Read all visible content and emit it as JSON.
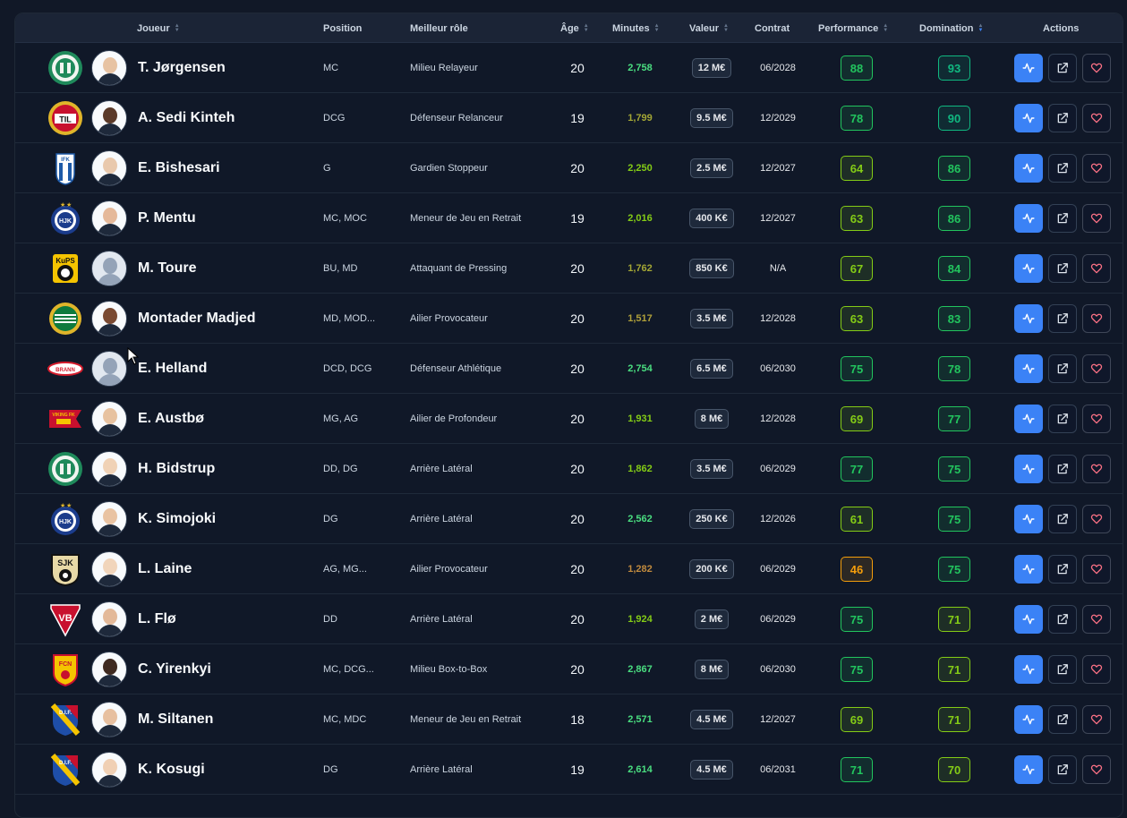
{
  "columns": {
    "player": "Joueur",
    "position": "Position",
    "best_role": "Meilleur rôle",
    "age": "Âge",
    "minutes": "Minutes",
    "value": "Valeur",
    "contract": "Contrat",
    "performance": "Performance",
    "domination": "Domination",
    "actions": "Actions"
  },
  "icons": {
    "stats_button": "activity-icon",
    "open_button": "external-link-icon",
    "favorite_button": "heart-icon",
    "sort": "sort-arrows-icon"
  },
  "colors": {
    "accent": "#3b82f6",
    "score_green": "#22c55e",
    "score_lime": "#84cc16",
    "score_amber": "#f59e0b"
  },
  "players": [
    {
      "name": "T. Jørgensen",
      "position": "MC",
      "role": "Milieu Relayeur",
      "age": "20",
      "minutes": "2,758",
      "value": "12 M€",
      "contract": "06/2028",
      "performance": "88",
      "domination": "93",
      "min_color": "#4ade80",
      "perf_color": "#22c55e",
      "dom_color": "#10b981",
      "crest": "green-round-crest"
    },
    {
      "name": "A. Sedi Kinteh",
      "position": "DCG",
      "role": "Défenseur Relanceur",
      "age": "19",
      "minutes": "1,799",
      "value": "9.5 M€",
      "contract": "12/2029",
      "performance": "78",
      "domination": "90",
      "min_color": "#a3a635",
      "perf_color": "#22c55e",
      "dom_color": "#10b981",
      "crest": "til-crest"
    },
    {
      "name": "E. Bishesari",
      "position": "G",
      "role": "Gardien Stoppeur",
      "age": "20",
      "minutes": "2,250",
      "value": "2.5 M€",
      "contract": "12/2027",
      "performance": "64",
      "domination": "86",
      "min_color": "#84cc16",
      "perf_color": "#84cc16",
      "dom_color": "#22c55e",
      "crest": "ifk-crest"
    },
    {
      "name": "P. Mentu",
      "position": "MC, MOC",
      "role": "Meneur de Jeu en Retrait",
      "age": "19",
      "minutes": "2,016",
      "value": "400 K€",
      "contract": "12/2027",
      "performance": "63",
      "domination": "86",
      "min_color": "#84cc16",
      "perf_color": "#84cc16",
      "dom_color": "#22c55e",
      "crest": "hjk-crest"
    },
    {
      "name": "M. Toure",
      "position": "BU, MD",
      "role": "Attaquant de Pressing",
      "age": "20",
      "minutes": "1,762",
      "value": "850 K€",
      "contract": "N/A",
      "performance": "67",
      "domination": "84",
      "min_color": "#a3a635",
      "perf_color": "#84cc16",
      "dom_color": "#22c55e",
      "crest": "kups-crest"
    },
    {
      "name": "Montader Madjed",
      "position": "MD, MOD...",
      "role": "Ailier Provocateur",
      "age": "20",
      "minutes": "1,517",
      "value": "3.5 M€",
      "contract": "12/2028",
      "performance": "63",
      "domination": "83",
      "min_color": "#b0a03a",
      "perf_color": "#84cc16",
      "dom_color": "#22c55e",
      "crest": "hammarby-crest"
    },
    {
      "name": "E. Helland",
      "position": "DCD, DCG",
      "role": "Défenseur Athlétique",
      "age": "20",
      "minutes": "2,754",
      "value": "6.5 M€",
      "contract": "06/2030",
      "performance": "75",
      "domination": "78",
      "min_color": "#4ade80",
      "perf_color": "#22c55e",
      "dom_color": "#22c55e",
      "crest": "brann-crest"
    },
    {
      "name": "E. Austbø",
      "position": "MG, AG",
      "role": "Ailier de Profondeur",
      "age": "20",
      "minutes": "1,931",
      "value": "8 M€",
      "contract": "12/2028",
      "performance": "69",
      "domination": "77",
      "min_color": "#84cc16",
      "perf_color": "#84cc16",
      "dom_color": "#22c55e",
      "crest": "viking-crest"
    },
    {
      "name": "H. Bidstrup",
      "position": "DD, DG",
      "role": "Arrière Latéral",
      "age": "20",
      "minutes": "1,862",
      "value": "3.5 M€",
      "contract": "06/2029",
      "performance": "77",
      "domination": "75",
      "min_color": "#84cc16",
      "perf_color": "#22c55e",
      "dom_color": "#22c55e",
      "crest": "green-round-crest"
    },
    {
      "name": "K. Simojoki",
      "position": "DG",
      "role": "Arrière Latéral",
      "age": "20",
      "minutes": "2,562",
      "value": "250 K€",
      "contract": "12/2026",
      "performance": "61",
      "domination": "75",
      "min_color": "#4ade80",
      "perf_color": "#84cc16",
      "dom_color": "#22c55e",
      "crest": "hjk-crest"
    },
    {
      "name": "L. Laine",
      "position": "AG, MG...",
      "role": "Ailier Provocateur",
      "age": "20",
      "minutes": "1,282",
      "value": "200 K€",
      "contract": "06/2029",
      "performance": "46",
      "domination": "75",
      "min_color": "#c08a3e",
      "perf_color": "#f59e0b",
      "dom_color": "#22c55e",
      "crest": "sjk-crest"
    },
    {
      "name": "L. Flø",
      "position": "DD",
      "role": "Arrière Latéral",
      "age": "20",
      "minutes": "1,924",
      "value": "2 M€",
      "contract": "06/2029",
      "performance": "75",
      "domination": "71",
      "min_color": "#84cc16",
      "perf_color": "#22c55e",
      "dom_color": "#84cc16",
      "crest": "vb-crest"
    },
    {
      "name": "C. Yirenkyi",
      "position": "MC, DCG...",
      "role": "Milieu Box-to-Box",
      "age": "20",
      "minutes": "2,867",
      "value": "8 M€",
      "contract": "06/2030",
      "performance": "75",
      "domination": "71",
      "min_color": "#4ade80",
      "perf_color": "#22c55e",
      "dom_color": "#84cc16",
      "crest": "fcn-crest"
    },
    {
      "name": "M. Siltanen",
      "position": "MC, MDC",
      "role": "Meneur de Jeu en Retrait",
      "age": "18",
      "minutes": "2,571",
      "value": "4.5 M€",
      "contract": "12/2027",
      "performance": "69",
      "domination": "71",
      "min_color": "#4ade80",
      "perf_color": "#84cc16",
      "dom_color": "#84cc16",
      "crest": "dif-crest"
    },
    {
      "name": "K. Kosugi",
      "position": "DG",
      "role": "Arrière Latéral",
      "age": "19",
      "minutes": "2,614",
      "value": "4.5 M€",
      "contract": "06/2031",
      "performance": "71",
      "domination": "70",
      "min_color": "#4ade80",
      "perf_color": "#22c55e",
      "dom_color": "#84cc16",
      "crest": "dif-crest"
    }
  ]
}
